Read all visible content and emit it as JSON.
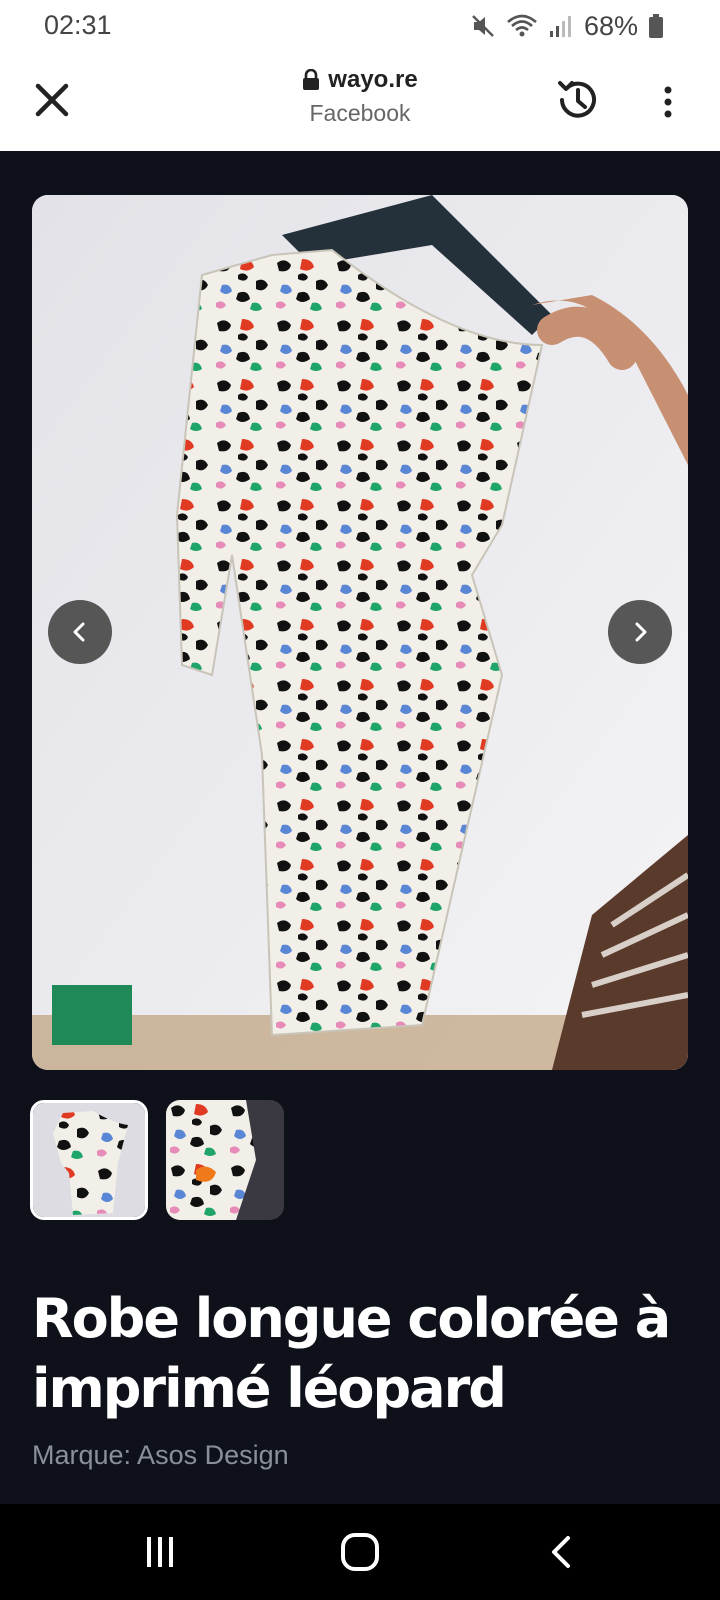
{
  "status_bar": {
    "time": "02:31",
    "battery": "68%",
    "icons": [
      "mute-icon",
      "wifi-icon",
      "signal-icon",
      "battery-icon"
    ]
  },
  "browser": {
    "url": "wayo.re",
    "site_name": "Facebook",
    "icons": [
      "close-icon",
      "lock-icon",
      "history-icon",
      "more-vert-icon"
    ]
  },
  "gallery": {
    "prev_icon": "chevron-left-icon",
    "next_icon": "chevron-right-icon",
    "thumbnail_count": 2,
    "selected_index": 0
  },
  "product": {
    "title": "Robe longue colorée à imprimé léopard",
    "brand": "Marque: Asos Design"
  },
  "system_nav": {
    "icons": [
      "recent-apps-icon",
      "home-icon",
      "back-icon"
    ]
  },
  "colors": {
    "page_bg": "#0e111a",
    "title_text": "#ffffff",
    "brand_text": "#8a8f9c"
  }
}
